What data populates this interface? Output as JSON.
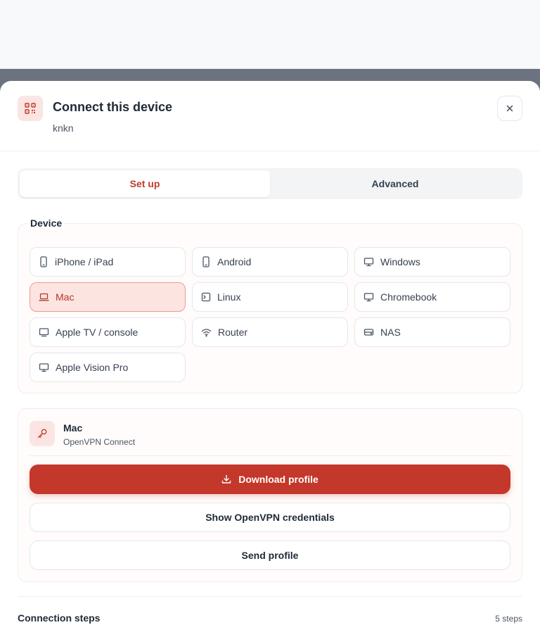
{
  "header": {
    "title": "Connect this device",
    "subtitle": "knkn"
  },
  "tabs": [
    {
      "label": "Set up",
      "active": true
    },
    {
      "label": "Advanced",
      "active": false
    }
  ],
  "device_section": {
    "legend": "Device",
    "devices": [
      {
        "label": "iPhone / iPad",
        "icon": "phone-icon",
        "selected": false
      },
      {
        "label": "Android",
        "icon": "phone-icon",
        "selected": false
      },
      {
        "label": "Windows",
        "icon": "monitor-icon",
        "selected": false
      },
      {
        "label": "Mac",
        "icon": "laptop-icon",
        "selected": true
      },
      {
        "label": "Linux",
        "icon": "terminal-icon",
        "selected": false
      },
      {
        "label": "Chromebook",
        "icon": "monitor-icon",
        "selected": false
      },
      {
        "label": "Apple TV / console",
        "icon": "tv-icon",
        "selected": false
      },
      {
        "label": "Router",
        "icon": "wifi-icon",
        "selected": false
      },
      {
        "label": "NAS",
        "icon": "hard-drive-icon",
        "selected": false
      },
      {
        "label": "Apple Vision Pro",
        "icon": "monitor-icon",
        "selected": false
      }
    ]
  },
  "profile": {
    "name": "Mac",
    "client": "OpenVPN Connect",
    "download_label": "Download profile",
    "credentials_label": "Show OpenVPN credentials",
    "send_label": "Send profile"
  },
  "steps": {
    "title": "Connection steps",
    "count": "5 steps"
  },
  "colors": {
    "accent": "#c4372b",
    "accent_soft": "#fce4e1",
    "backdrop": "#6b7280"
  }
}
